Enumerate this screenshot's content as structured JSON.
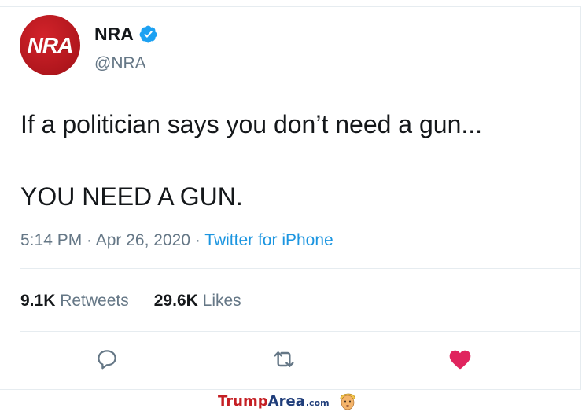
{
  "user": {
    "avatar_text": "NRA",
    "display_name": "NRA",
    "handle": "@NRA",
    "verified": true
  },
  "tweet": {
    "text": "If a politician says you don’t need a gun...\n\nYOU NEED A GUN.",
    "time": "5:14 PM",
    "sep1": " · ",
    "date": "Apr 26, 2020",
    "sep2": " · ",
    "source": "Twitter for iPhone"
  },
  "stats": {
    "retweets_count": "9.1K",
    "retweets_label": "Retweets",
    "likes_count": "29.6K",
    "likes_label": "Likes"
  },
  "actions": {
    "reply_icon": "reply-icon",
    "retweet_icon": "retweet-icon",
    "like_icon": "heart-icon",
    "liked": true
  },
  "watermark": {
    "brand_part1": "Trump",
    "brand_part2": "Area",
    "brand_part3": ".com"
  },
  "colors": {
    "accent": "#1b95e0",
    "like": "#e0245e",
    "brand_red": "#c51f24",
    "brand_blue": "#1f3d7a"
  }
}
